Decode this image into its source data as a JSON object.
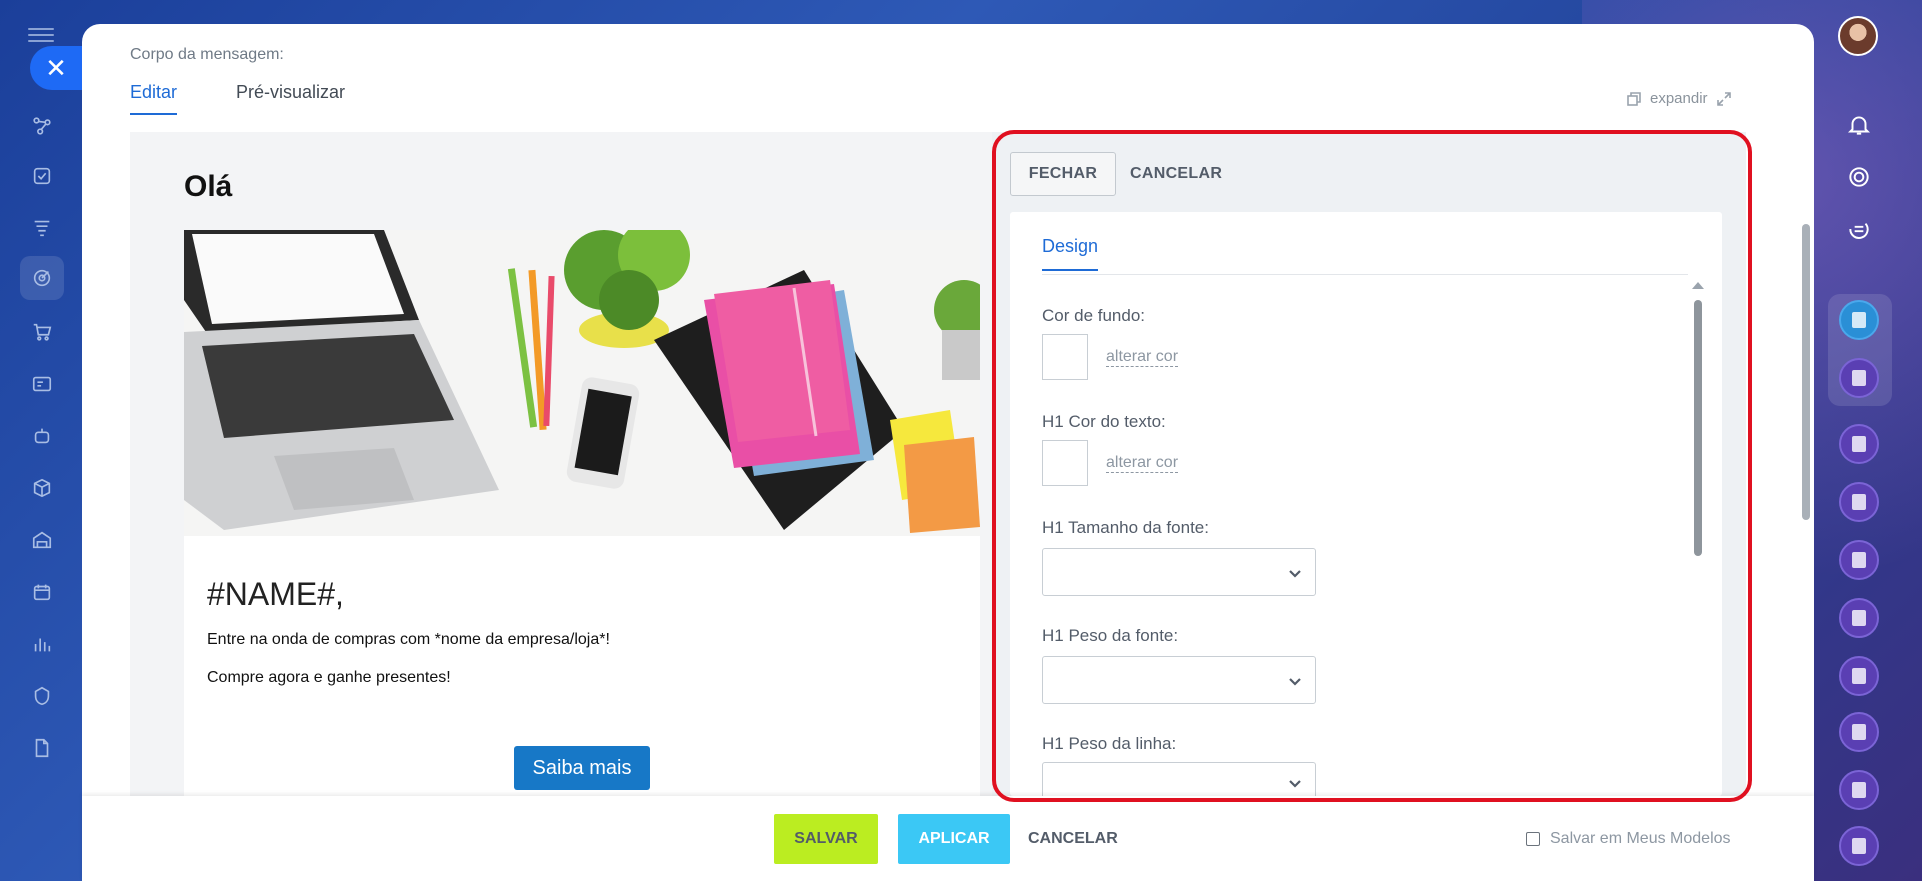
{
  "left_rail": {
    "icons": [
      "menu-icon",
      "close-icon",
      "flow-icon",
      "tasks-icon",
      "funnel-icon",
      "target-icon",
      "cart-icon",
      "contact-card-icon",
      "robot-icon",
      "box-icon",
      "warehouse-icon",
      "calendar-icon",
      "chart-icon",
      "shield-icon",
      "document-icon"
    ]
  },
  "main": {
    "body_label": "Corpo da mensagem:",
    "tabs": [
      {
        "label": "Editar",
        "active": true
      },
      {
        "label": "Pré-visualizar",
        "active": false
      }
    ],
    "expand_label": "expandir"
  },
  "email": {
    "greeting": "Olá",
    "name_placeholder": "#NAME#,",
    "line1": "Entre na onda de compras com *nome da empresa/loja*!",
    "line2": "Compre agora e ganhe presentes!",
    "cta_label": "Saiba mais"
  },
  "settings_panel": {
    "close_button": "FECHAR",
    "cancel_button": "CANCELAR",
    "tab": "Design",
    "fields": [
      {
        "label": "Cor de fundo:",
        "type": "color",
        "action": "alterar cor"
      },
      {
        "label": "H1 Cor do texto:",
        "type": "color",
        "action": "alterar cor"
      },
      {
        "label": "H1 Tamanho da fonte:",
        "type": "select",
        "value": ""
      },
      {
        "label": "H1 Peso da fonte:",
        "type": "select",
        "value": ""
      },
      {
        "label": "H1 Peso da linha:",
        "type": "select",
        "value": ""
      }
    ]
  },
  "footer": {
    "save": "SALVAR",
    "apply": "APLICAR",
    "cancel": "CANCELAR",
    "save_template_label": "Salvar em Meus Modelos",
    "save_template_checked": false
  },
  "colors": {
    "accent": "#1e6bd6",
    "save_green": "#bbed21",
    "apply_blue": "#3bc8f5",
    "highlight_red": "#e01020",
    "cta_blue": "#1778c7"
  }
}
